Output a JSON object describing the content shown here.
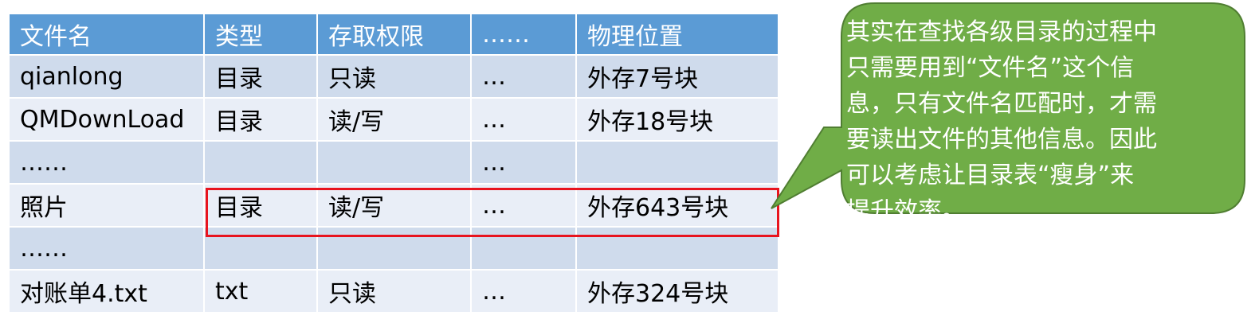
{
  "table": {
    "headers": [
      "文件名",
      "类型",
      "存取权限",
      "……",
      "物理位置"
    ],
    "rows": [
      [
        "qianlong",
        "目录",
        "只读",
        "…",
        "外存7号块"
      ],
      [
        "QMDownLoad",
        "目录",
        "读/写",
        "…",
        "外存18号块"
      ],
      [
        "……",
        "",
        "",
        "…",
        ""
      ],
      [
        "照片",
        "目录",
        "读/写",
        "…",
        "外存643号块"
      ],
      [
        "……",
        "",
        "",
        "",
        ""
      ],
      [
        "对账单4.txt",
        "txt",
        "只读",
        "…",
        "外存324号块"
      ]
    ]
  },
  "callout": {
    "lines": [
      "其实在查找各级目录的过程中",
      "只需要用到“文件名”这个信",
      "息，只有文件名匹配时，才需",
      "要读出文件的其他信息。因此",
      "可以考虑让目录表“瘦身”来",
      "提升效率。"
    ]
  },
  "colors": {
    "header_bg": "#5b9bd5",
    "row_odd_bg": "#cfdbec",
    "row_even_bg": "#e9eef7",
    "highlight_border": "#e8141e",
    "callout_fill": "#70ad47",
    "callout_border": "#507e32"
  }
}
